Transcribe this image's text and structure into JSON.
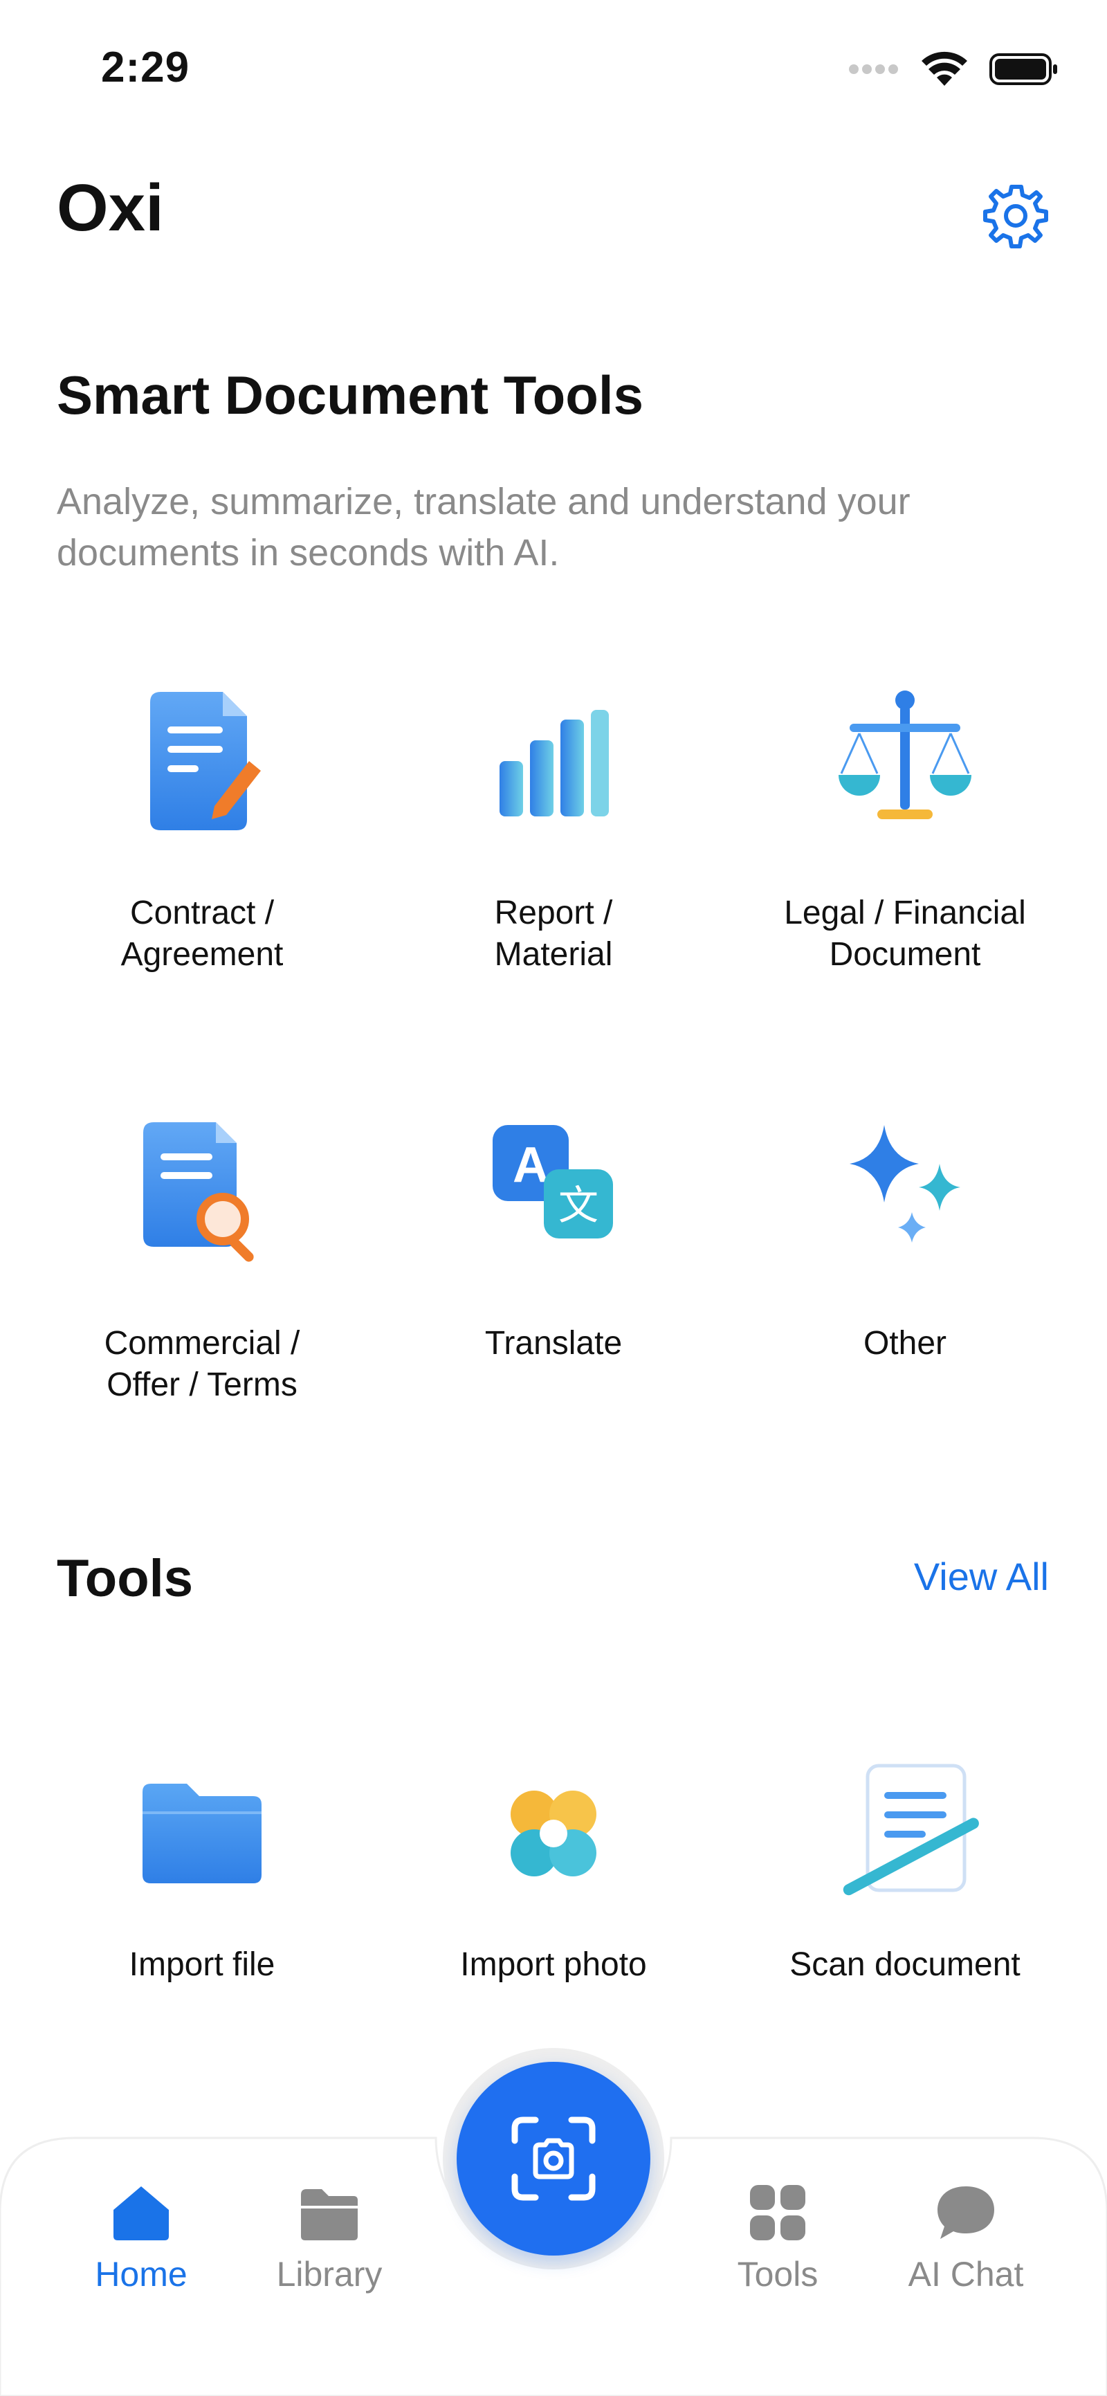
{
  "status": {
    "time": "2:29"
  },
  "header": {
    "title": "Oxi"
  },
  "hero": {
    "title": "Smart Document Tools",
    "subtitle": "Analyze, summarize, translate and understand your documents in seconds with AI."
  },
  "doc_types": [
    {
      "label_line1": "Contract /",
      "label_line2": "Agreement",
      "icon": "contract-icon"
    },
    {
      "label_line1": "Report /",
      "label_line2": "Material",
      "icon": "bar-chart-icon"
    },
    {
      "label_line1": "Legal / Financial",
      "label_line2": "Document",
      "icon": "scales-icon"
    },
    {
      "label_line1": "Commercial /",
      "label_line2": "Offer / Terms",
      "icon": "document-search-icon"
    },
    {
      "label_line1": "Translate",
      "label_line2": "",
      "icon": "translate-icon"
    },
    {
      "label_line1": "Other",
      "label_line2": "",
      "icon": "sparkles-icon"
    }
  ],
  "tools": {
    "title": "Tools",
    "view_all": "View All",
    "items": [
      {
        "label": "Import file",
        "icon": "folder-icon"
      },
      {
        "label": "Import photo",
        "icon": "photo-flower-icon"
      },
      {
        "label": "Scan document",
        "icon": "scan-document-icon"
      }
    ]
  },
  "nav": {
    "items": [
      {
        "label": "Home",
        "icon": "home-icon",
        "active": true
      },
      {
        "label": "Library",
        "icon": "folder-icon",
        "active": false
      },
      {
        "label": "Tools",
        "icon": "grid-icon",
        "active": false
      },
      {
        "label": "AI Chat",
        "icon": "chat-bubble-icon",
        "active": false
      }
    ],
    "fab_icon": "camera-scan-icon"
  },
  "colors": {
    "accent": "#1a73e8",
    "fab": "#1f6ff0",
    "orange": "#f07c2a",
    "teal": "#35b7d1"
  }
}
